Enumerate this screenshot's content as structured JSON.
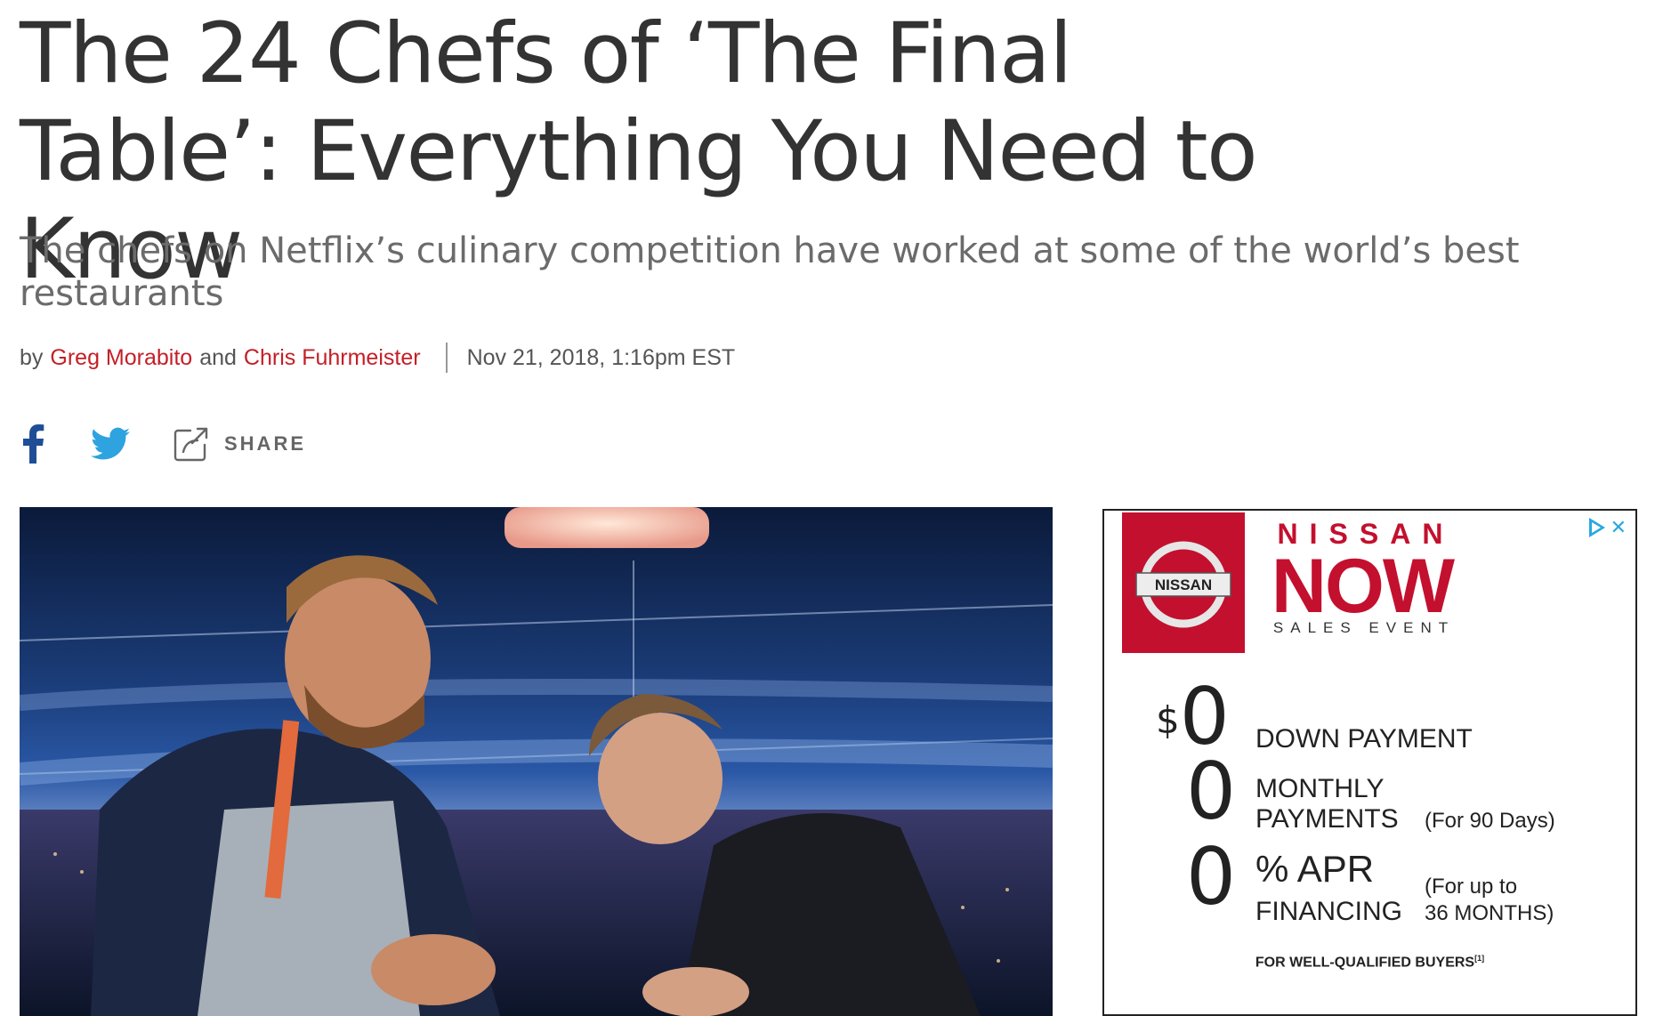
{
  "article": {
    "headline": "The 24 Chefs of ‘The Final Table’: Everything You Need to Know",
    "dek": "The chefs on Netflix’s culinary competition have worked at some of the world’s best restaurants",
    "byline": {
      "by": "by",
      "author1": "Greg Morabito",
      "and": "and",
      "author2": "Chris Fuhrmeister",
      "date": "Nov 21, 2018, 1:16pm EST"
    },
    "share": {
      "facebook_icon": "facebook-icon",
      "twitter_icon": "twitter-icon",
      "share_icon": "share-icon",
      "share_label": "SHARE"
    }
  },
  "ad": {
    "logo_text": "NISSAN",
    "brand": "NISSAN",
    "headline": "NOW",
    "event": "SALES EVENT",
    "offers": [
      {
        "big": "0",
        "prefix": "$",
        "line1": "DOWN PAYMENT",
        "line2": "",
        "note": ""
      },
      {
        "big": "0",
        "prefix": "",
        "line1": "MONTHLY",
        "line2": "PAYMENTS",
        "note": "(For 90 Days)"
      },
      {
        "big": "0",
        "prefix": "",
        "line1": "% APR",
        "line2": "FINANCING",
        "note": "(For up to",
        "note2": "36 MONTHS)"
      }
    ],
    "fine_print": "FOR WELL-QUALIFIED BUYERS",
    "footnote": "[1]",
    "colors": {
      "brand": "#c3102e",
      "adchoices": "#29a8e0"
    }
  }
}
